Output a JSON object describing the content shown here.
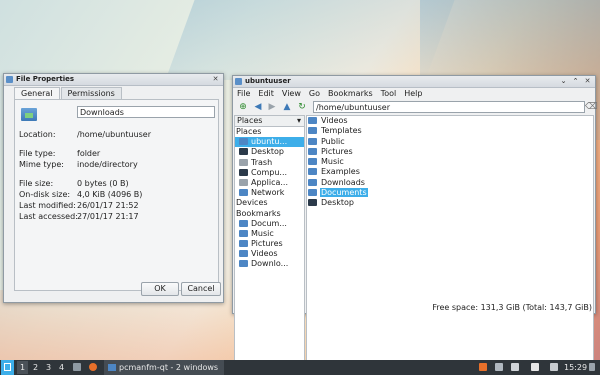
{
  "file_properties": {
    "title": "File Properties",
    "tabs": [
      "General",
      "Permissions"
    ],
    "name_value": "Downloads",
    "rows": [
      {
        "key": "Location:",
        "value": "/home/ubuntuuser"
      },
      {
        "key": "File type:",
        "value": "folder"
      },
      {
        "key": "Mime type:",
        "value": "inode/directory"
      },
      {
        "key": "File size:",
        "value": "0 bytes (0 B)"
      },
      {
        "key": "On-disk size:",
        "value": "4,0 KiB (4096 B)"
      },
      {
        "key": "Last modified:",
        "value": "26/01/17 21:52"
      },
      {
        "key": "Last accessed:",
        "value": "27/01/17 21:17"
      }
    ],
    "ok_label": "OK",
    "cancel_label": "Cancel"
  },
  "file_manager": {
    "title": "ubuntuuser",
    "menu": [
      "File",
      "Edit",
      "View",
      "Go",
      "Bookmarks",
      "Tool",
      "Help"
    ],
    "path": "/home/ubuntuuser",
    "side_header": "Places",
    "side": {
      "places_label": "Places",
      "places": [
        "ubuntu...",
        "Desktop",
        "Trash",
        "Compu...",
        "Applica...",
        "Network"
      ],
      "devices_label": "Devices",
      "bookmarks_label": "Bookmarks",
      "bookmarks": [
        "Docum...",
        "Music",
        "Pictures",
        "Videos",
        "Downlo..."
      ]
    },
    "items": [
      "Videos",
      "Templates",
      "Public",
      "Pictures",
      "Music",
      "Examples",
      "Downloads",
      "Documents",
      "Desktop"
    ],
    "selected_item": "Documents",
    "status": "Free space: 131,3 GiB (Total: 143,7 GiB)"
  },
  "taskbar": {
    "desktops": [
      "1",
      "2",
      "3",
      "4"
    ],
    "task_label": "pcmanfm-qt - 2 windows",
    "clock": "15:29"
  },
  "colors": {
    "selection": "#3daee9",
    "taskbar": "#2f353a"
  }
}
